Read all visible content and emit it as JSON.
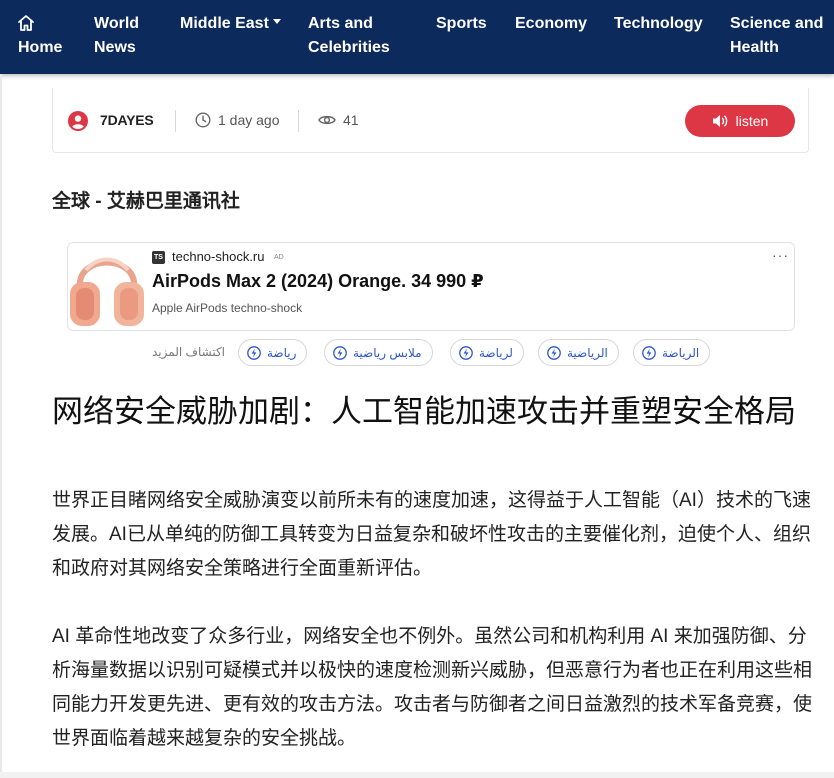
{
  "nav": {
    "home_label": "Home",
    "items": [
      {
        "line1": "World",
        "line2": "News"
      },
      {
        "line1": "Middle East",
        "line2": ""
      },
      {
        "line1": "Arts and",
        "line2": "Celebrities"
      },
      {
        "line1": "Sports",
        "line2": ""
      },
      {
        "line1": "Economy",
        "line2": ""
      },
      {
        "line1": "Technology",
        "line2": ""
      },
      {
        "line1": "Science and",
        "line2": "Health"
      }
    ],
    "colors": {
      "background": "#0d2a5c",
      "text": "#ffffff"
    }
  },
  "meta": {
    "author": "7DAYES",
    "time": "1 day ago",
    "views": "41",
    "listen_label": "listen",
    "icons": [
      "user-icon",
      "clock-icon",
      "eye-icon",
      "speaker-icon"
    ],
    "listen_color": "#dd3645"
  },
  "source_line": "全球 - 艾赫巴里通讯社",
  "ad": {
    "badge": "TS",
    "domain": "techno-shock.ru",
    "tag": "AD",
    "title": "AirPods Max 2 (2024) Orange. 34 990 ₽",
    "subtitle": "Apple AirPods techno-shock",
    "more": "···"
  },
  "explore": {
    "label": "اكتشاف المزيد",
    "chips": [
      "رياضة",
      "ملابس رياضية",
      "لرياضة",
      "الرياضية",
      "الرياضة"
    ]
  },
  "article": {
    "headline": "网络安全威胁加剧：人工智能加速攻击并重塑安全格局",
    "paragraphs": [
      "世界正目睹网络安全威胁演变以前所未有的速度加速，这得益于人工智能（AI）技术的飞速发展。AI已从单纯的防御工具转变为日益复杂和破坏性攻击的主要催化剂，迫使个人、组织和政府对其网络安全策略进行全面重新评估。",
      "AI 革命性地改变了众多行业，网络安全也不例外。虽然公司和机构利用 AI 来加强防御、分析海量数据以识别可疑模式并以极快的速度检测新兴威胁，但恶意行为者也正在利用这些相同能力开发更先进、更有效的攻击方法。攻击者与防御者之间日益激烈的技术军备竞赛，使世界面临着越来越复杂的安全挑战。"
    ]
  }
}
